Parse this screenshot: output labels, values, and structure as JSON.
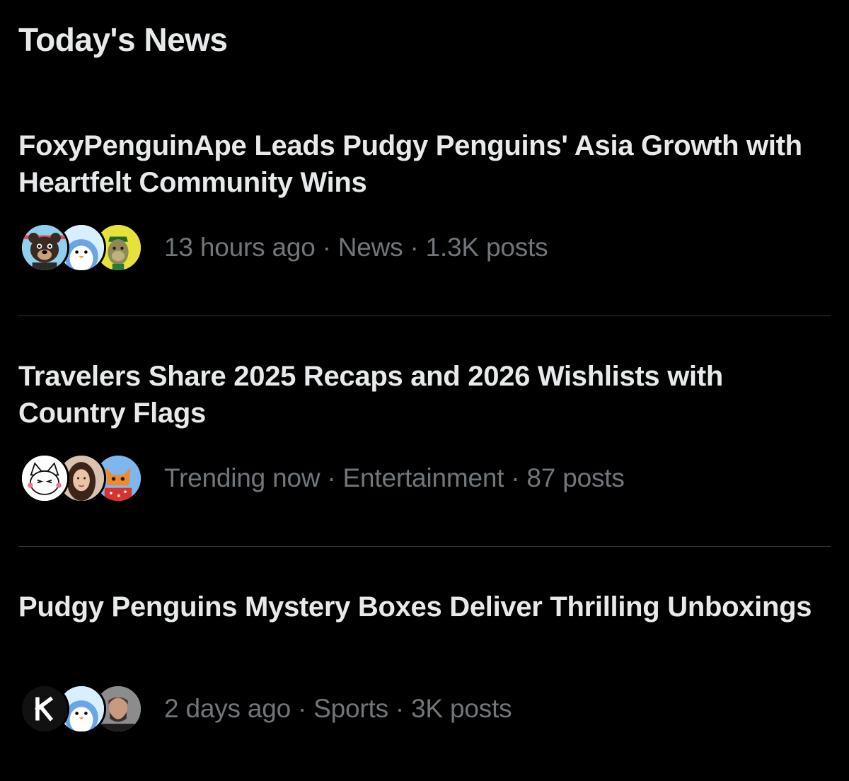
{
  "section": {
    "title": "Today's News"
  },
  "items": [
    {
      "headline": "FoxyPenguinApe Leads Pudgy Penguins' Asia Growth with Heartfelt Community Wins",
      "time": "13 hours ago",
      "category": "News",
      "posts": "1.3K posts",
      "separator": "·",
      "avatars": [
        "bear-avatar",
        "penguin-avatar",
        "ape-avatar"
      ]
    },
    {
      "headline": "Travelers Share 2025 Recaps and 2026 Wishlists with Country Flags",
      "time": "Trending now",
      "category": "Entertainment",
      "posts": "87 posts",
      "separator": "·",
      "avatars": [
        "cat-avatar",
        "woman-avatar",
        "fox-avatar"
      ]
    },
    {
      "headline": "Pudgy Penguins Mystery Boxes Deliver Thrilling Unboxings",
      "time": "2 days ago",
      "category": "Sports",
      "posts": "3K posts",
      "separator": "·",
      "avatars": [
        "k-logo-avatar",
        "penguin-avatar",
        "man-avatar"
      ]
    }
  ],
  "colors": {
    "background": "#000000",
    "text_primary": "#e7e9ea",
    "text_secondary": "#71767b",
    "divider": "#2f3336"
  }
}
